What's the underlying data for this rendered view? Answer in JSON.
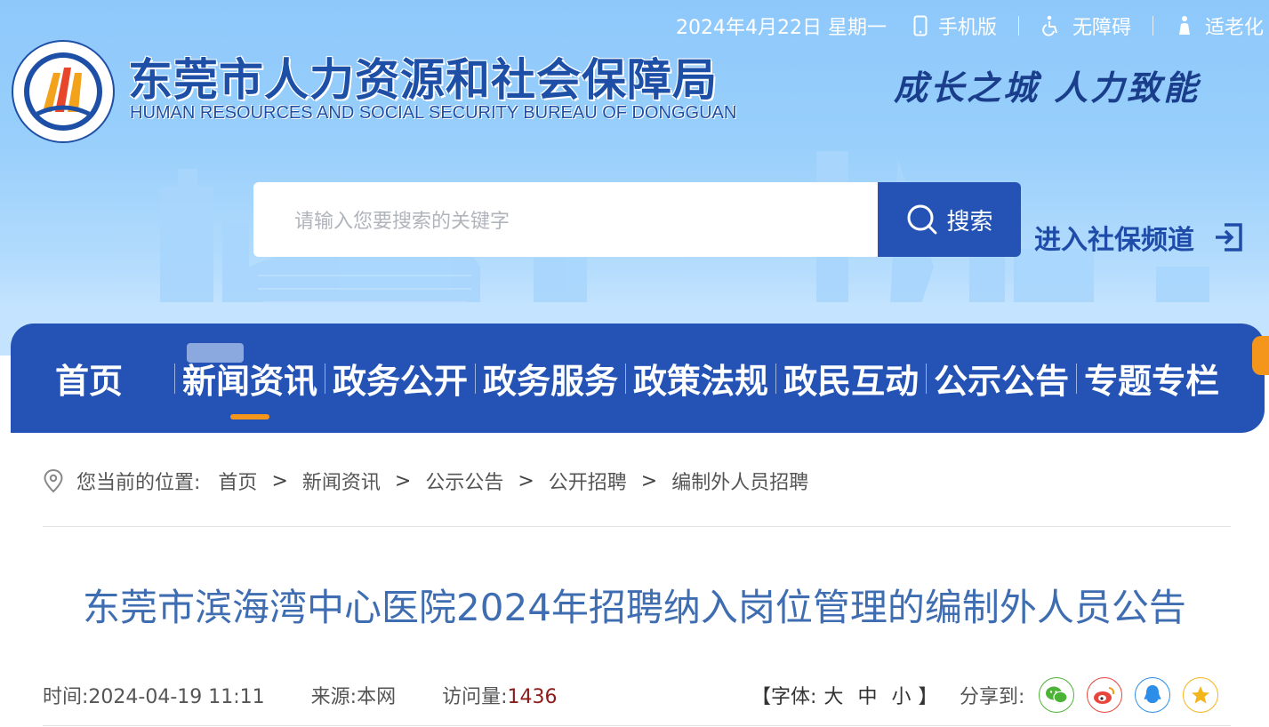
{
  "topbar": {
    "date": "2024年4月22日 星期一",
    "mobile_label": "手机版",
    "accessibility_label": "无障碍",
    "elderly_label": "适老化"
  },
  "brand": {
    "name_cn": "东莞市人力资源和社会保障局",
    "name_en": "HUMAN RESOURCES AND SOCIAL SECURITY BUREAU OF DONGGUAN",
    "slogan": "成长之城  人力致能"
  },
  "search": {
    "placeholder": "请输入您要搜索的关键字",
    "button_label": "搜索"
  },
  "social_channel": {
    "label": "进入社保频道"
  },
  "nav": {
    "items": [
      {
        "label": "首页"
      },
      {
        "label": "新闻资讯"
      },
      {
        "label": "政务公开"
      },
      {
        "label": "政务服务"
      },
      {
        "label": "政策法规"
      },
      {
        "label": "政民互动"
      },
      {
        "label": "公示公告"
      },
      {
        "label": "专题专栏"
      }
    ],
    "active_index": 1
  },
  "breadcrumb": {
    "label": "您当前的位置:",
    "items": [
      "首页",
      "新闻资讯",
      "公示公告",
      "公开招聘",
      "编制外人员招聘"
    ],
    "separator": ">"
  },
  "article": {
    "title": "东莞市滨海湾中心医院2024年招聘纳入岗位管理的编制外人员公告",
    "time_label": "时间:",
    "time_value": "2024-04-19 11:11",
    "source_label": "来源:",
    "source_value": "本网",
    "visits_label": "访问量:",
    "visits_value": "1436"
  },
  "font_size": {
    "open_bracket": "【字体:",
    "large": "大",
    "medium": "中",
    "small": "小",
    "close_bracket": "】"
  },
  "share": {
    "label": "分享到:",
    "targets": [
      "wechat-icon",
      "weibo-icon",
      "qq-icon",
      "qzone-icon"
    ]
  },
  "colors": {
    "primary": "#2553b5",
    "accent": "#f4951c",
    "title": "#3f6db1",
    "visits": "#8c1c1c"
  }
}
